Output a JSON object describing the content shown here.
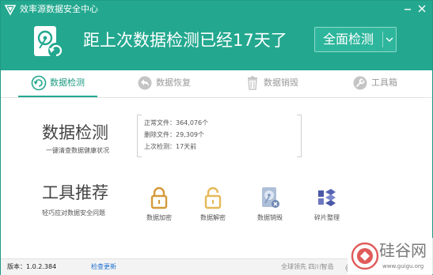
{
  "window": {
    "title": "效率源数据安全中心",
    "controls": [
      "minimize",
      "close"
    ],
    "accent_color": "#23a88f"
  },
  "header": {
    "headline": "距上次数据检测已经17天了",
    "primary_button": "全面检测",
    "dropdown_icon": "chevron-down-icon",
    "disk_icon": "hard-disk-refresh-icon"
  },
  "tabs": [
    {
      "label": "数据检测",
      "icon": "refresh-icon",
      "active": true
    },
    {
      "label": "数据恢复",
      "icon": "undo-icon",
      "active": false
    },
    {
      "label": "数据销毁",
      "icon": "trash-icon",
      "active": false
    },
    {
      "label": "工具箱",
      "icon": "wrench-icon",
      "active": false
    }
  ],
  "detection": {
    "title": "数据检测",
    "subtitle": "一键清查数据健康状况",
    "stats": [
      {
        "label": "正常文件：",
        "value": "364,076个"
      },
      {
        "label": "删除文件：",
        "value": "29,309个"
      },
      {
        "label": "上次检测：",
        "value": "17天前"
      }
    ]
  },
  "tools": {
    "title": "工具推荐",
    "subtitle": "轻巧应对数据安全问题",
    "items": [
      {
        "label": "数据加密",
        "icon": "lock-icon"
      },
      {
        "label": "数据解密",
        "icon": "unlock-icon"
      },
      {
        "label": "数据销毁",
        "icon": "disk-erase-icon"
      },
      {
        "label": "碎片整理",
        "icon": "defrag-icon"
      }
    ]
  },
  "status": {
    "version": "版本：1.0.2.384",
    "update_link": "检查更新",
    "brand": "全球领先 四川智造",
    "hotkey": "《"
  },
  "watermark": {
    "text": "硅谷网",
    "url": "www.guigu.org"
  }
}
